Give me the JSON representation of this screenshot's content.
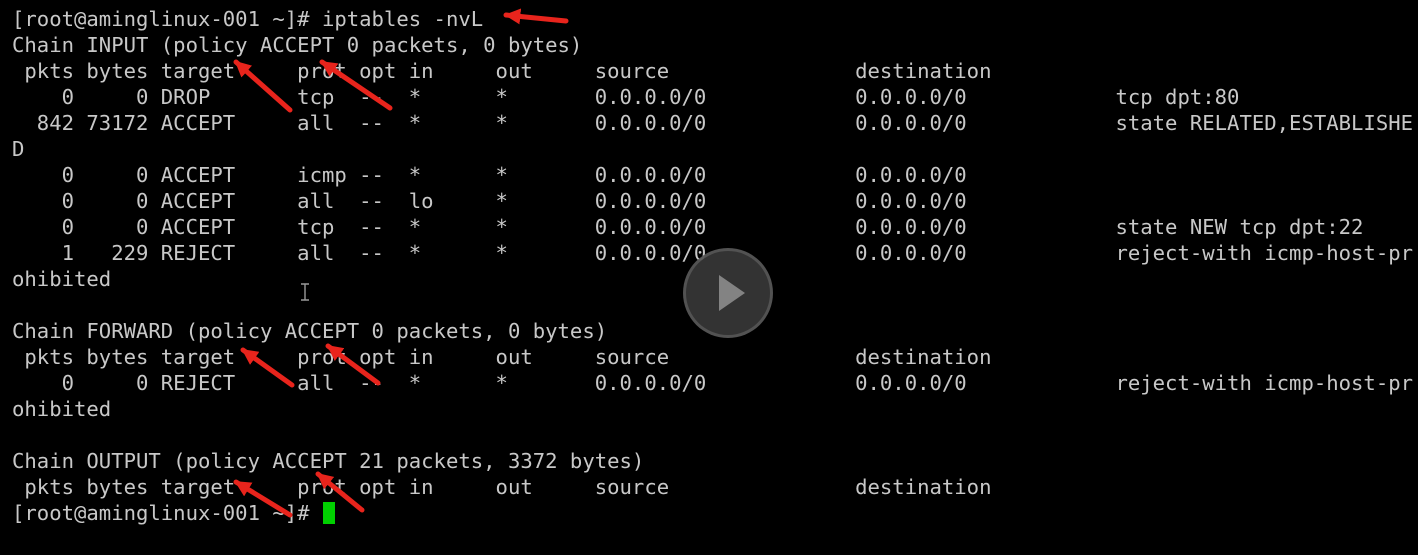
{
  "terminal": {
    "cursor_color": "#00d000",
    "text_color": "#c8c8c8",
    "background_color": "#000000",
    "arrow_color": "#e8241c",
    "lines": [
      "[root@aminglinux-001 ~]# iptables -nvL",
      "Chain INPUT (policy ACCEPT 0 packets, 0 bytes)",
      " pkts bytes target     prot opt in     out     source               destination         ",
      "    0     0 DROP       tcp  --  *      *       0.0.0.0/0            0.0.0.0/0            tcp dpt:80",
      "  842 73172 ACCEPT     all  --  *      *       0.0.0.0/0            0.0.0.0/0            state RELATED,ESTABLISHE",
      "D",
      "    0     0 ACCEPT     icmp --  *      *       0.0.0.0/0            0.0.0.0/0           ",
      "    0     0 ACCEPT     all  --  lo     *       0.0.0.0/0            0.0.0.0/0           ",
      "    0     0 ACCEPT     tcp  --  *      *       0.0.0.0/0            0.0.0.0/0            state NEW tcp dpt:22",
      "    1   229 REJECT     all  --  *      *       0.0.0.0/0            0.0.0.0/0            reject-with icmp-host-pr",
      "ohibited",
      "",
      "Chain FORWARD (policy ACCEPT 0 packets, 0 bytes)",
      " pkts bytes target     prot opt in     out     source               destination         ",
      "    0     0 REJECT     all  --  *      *       0.0.0.0/0            0.0.0.0/0            reject-with icmp-host-pr",
      "ohibited",
      "",
      "Chain OUTPUT (policy ACCEPT 21 packets, 3372 bytes)",
      " pkts bytes target     prot opt in     out     source               destination         ",
      "[root@aminglinux-001 ~]# "
    ]
  },
  "overlay": {
    "play_icon": "play-icon",
    "text_cursor_icon": "ibeam-cursor-icon"
  }
}
